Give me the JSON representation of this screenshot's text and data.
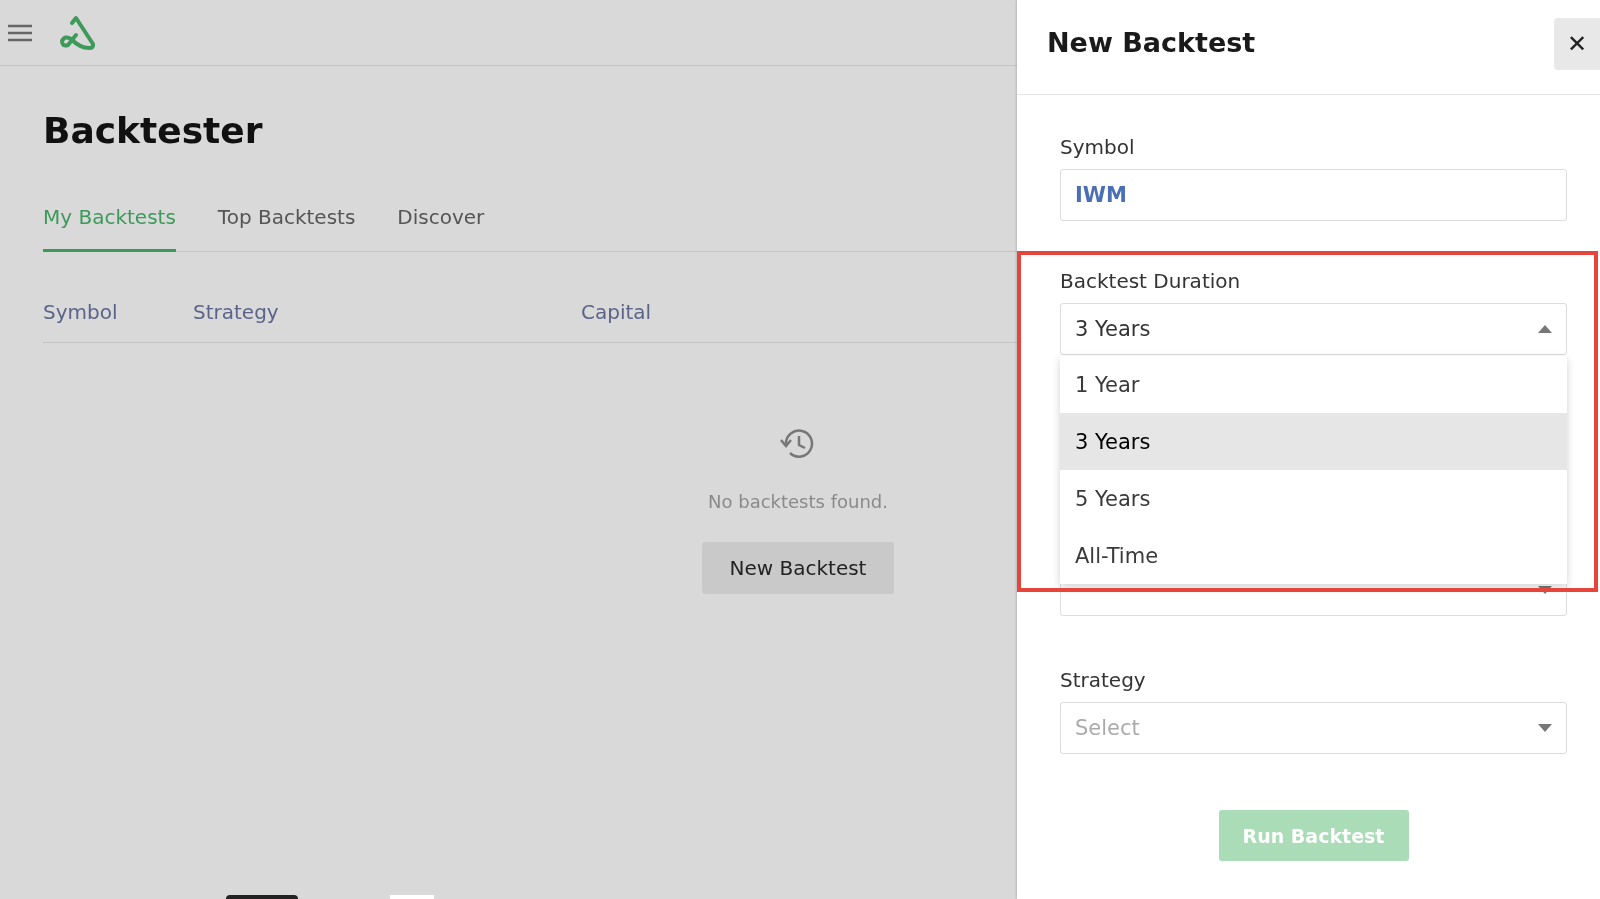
{
  "page": {
    "title": "Backtester"
  },
  "tabs": [
    {
      "label": "My Backtests",
      "selected": true
    },
    {
      "label": "Top Backtests",
      "selected": false
    },
    {
      "label": "Discover",
      "selected": false
    }
  ],
  "table": {
    "columns": [
      "Symbol",
      "Strategy",
      "Capital"
    ]
  },
  "empty_state": {
    "message": "No backtests found.",
    "button": "New Backtest"
  },
  "drawer": {
    "title": "New Backtest",
    "close": "✕",
    "symbol": {
      "label": "Symbol",
      "value": "IWM"
    },
    "duration": {
      "label": "Backtest Duration",
      "value": "3 Years",
      "expanded": true,
      "options": [
        {
          "label": "1 Year",
          "selected": false
        },
        {
          "label": "3 Years",
          "selected": true
        },
        {
          "label": "5 Years",
          "selected": false
        },
        {
          "label": "All-Time",
          "selected": false
        }
      ]
    },
    "strategy": {
      "label": "Strategy",
      "placeholder": "Select"
    },
    "run_button": {
      "label": "Run Backtest",
      "disabled": true
    }
  }
}
